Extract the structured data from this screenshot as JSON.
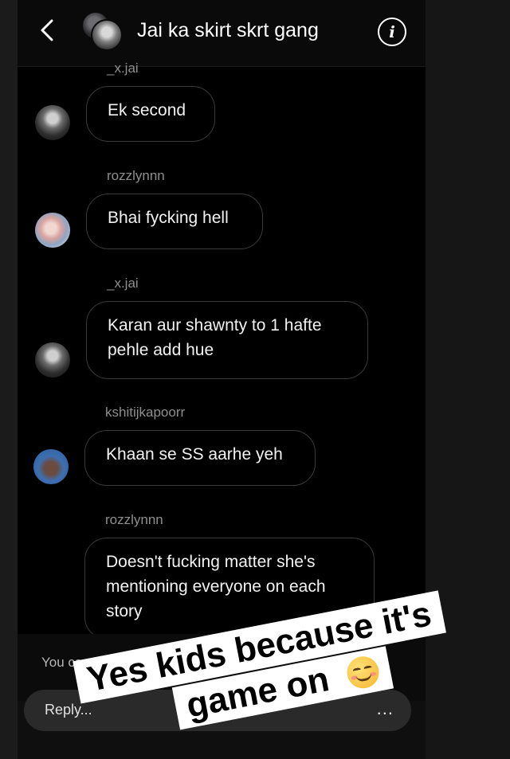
{
  "header": {
    "back_icon": "chevron-left-icon",
    "title": "Jai ka skirt skrt gang",
    "info_icon": "info-icon",
    "info_glyph": "i"
  },
  "messages": [
    {
      "username": "_x.jai",
      "text": "Ek second",
      "avatar": "avatar-jai"
    },
    {
      "username": "rozzlynnn",
      "text": "Bhai fycking hell",
      "avatar": "avatar-rozzlynnn"
    },
    {
      "username": "_x.jai",
      "text": "Karan aur shawnty to 1 hafte pehle add hue",
      "avatar": "avatar-jai"
    },
    {
      "username": "kshitijkapoorr",
      "text": "Khaan se SS aarhe yeh",
      "avatar": "avatar-kshitijkapoorr"
    },
    {
      "username": "rozzlynnn",
      "text": "Doesn't fucking matter she's mentioning everyone on each story",
      "avatar": "avatar-rozzlynnn"
    }
  ],
  "footer": {
    "cant_reply_partial": "You ca",
    "reply_placeholder": "Reply...",
    "more_label": "..."
  },
  "sticker": {
    "line1": "Yes kids because it's",
    "line2": "game on",
    "emoji": "smiling-face-icon"
  },
  "colors": {
    "background": "#000000",
    "bubble_border": "#3a3a3a",
    "username": "#8e8e8e",
    "reply_field": "#2a2a2b",
    "sticker_bg": "#ffffff"
  }
}
